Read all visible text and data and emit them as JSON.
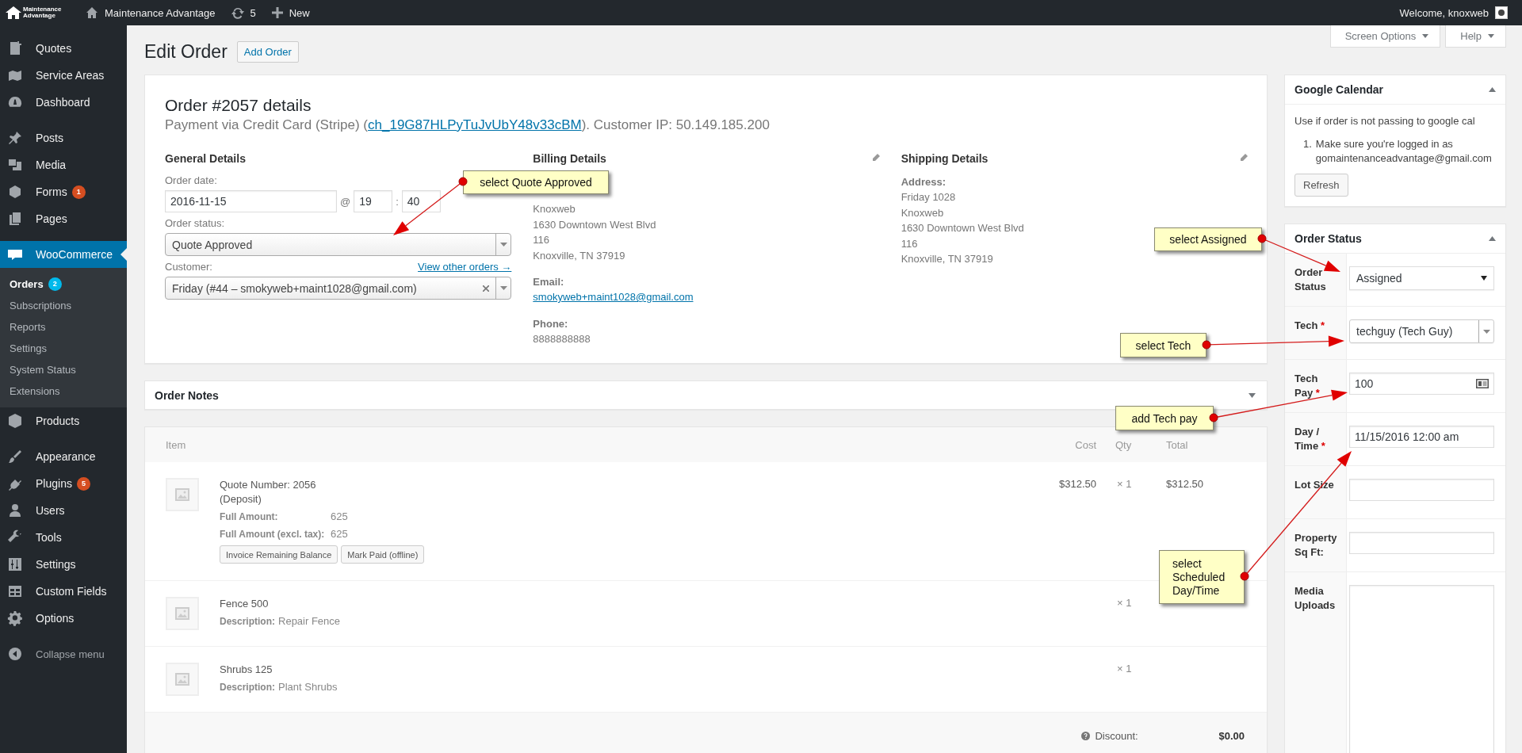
{
  "top_bar": {
    "logo_text": "Maintenance Advantage",
    "site_name": "Maintenance Advantage",
    "updates": "5",
    "new_label": "New",
    "welcome": "Welcome, knoxweb"
  },
  "sidebar": {
    "groups": [
      [
        {
          "label": "Quotes",
          "selected": false
        },
        {
          "label": "Service Areas",
          "selected": false
        },
        {
          "label": "Dashboard",
          "selected": false
        }
      ],
      [
        {
          "label": "Posts",
          "selected": false
        },
        {
          "label": "Media",
          "selected": false
        },
        {
          "label": "Forms",
          "selected": false,
          "badge": "1",
          "color": "#d54e21"
        },
        {
          "label": "Pages",
          "selected": false
        }
      ],
      [
        {
          "label": "WooCommerce",
          "selected": true,
          "children": [
            {
              "label": "Orders",
              "selected": true,
              "badge": "2",
              "color": "#00b9eb"
            },
            {
              "label": "Subscriptions",
              "selected": false
            },
            {
              "label": "Reports",
              "selected": false
            },
            {
              "label": "Settings",
              "selected": false
            },
            {
              "label": "System Status",
              "selected": false
            },
            {
              "label": "Extensions",
              "selected": false
            }
          ]
        },
        {
          "label": "Products",
          "selected": false
        }
      ],
      [
        {
          "label": "Appearance",
          "selected": false
        },
        {
          "label": "Plugins",
          "selected": false,
          "badge": "5",
          "color": "#d54e21"
        },
        {
          "label": "Users",
          "selected": false
        },
        {
          "label": "Tools",
          "selected": false
        },
        {
          "label": "Settings",
          "selected": false
        },
        {
          "label": "Custom Fields",
          "selected": false
        },
        {
          "label": "Options",
          "selected": false
        }
      ]
    ],
    "collapse_label": "Collapse menu"
  },
  "header": {
    "title": "Edit Order",
    "add_button": "Add Order",
    "screen_options": "Screen Options",
    "help": "Help"
  },
  "order": {
    "title": "Order #2057 details",
    "payment_prefix": "Payment via Credit Card (Stripe) (",
    "payment_link": "ch_19G87HLPyTuJvUbY48v33cBM",
    "payment_suffix": "). Customer IP: 50.149.185.200",
    "general": {
      "heading": "General Details",
      "date_label": "Order date:",
      "date": "2016-11-15",
      "at": "@",
      "hour": "19",
      "colon": ":",
      "minute": "40",
      "status_label": "Order status:",
      "status": "Quote Approved",
      "customer_label": "Customer:",
      "view_orders": "View other orders →",
      "customer": "Friday (#44 – smokyweb+maint1028@gmail.com)"
    },
    "billing": {
      "heading": "Billing Details",
      "lines": [
        "Knoxweb",
        "1630 Downtown West Blvd",
        "116",
        "Knoxville, TN 37919"
      ],
      "email_label": "Email:",
      "email": "smokyweb+maint1028@gmail.com",
      "phone_label": "Phone:",
      "phone": "8888888888"
    },
    "shipping": {
      "heading": "Shipping Details",
      "address_label": "Address:",
      "lines": [
        "Friday 1028",
        "Knoxweb",
        "1630 Downtown West Blvd",
        "116",
        "Knoxville, TN 37919"
      ]
    }
  },
  "order_notes": {
    "title": "Order Notes"
  },
  "items": {
    "columns": [
      "Item",
      "Cost",
      "Qty",
      "Total"
    ],
    "rows": [
      {
        "name_lines": [
          "Quote Number: 2056",
          "(Deposit)"
        ],
        "meta": [
          {
            "label": "Full Amount:",
            "value": "625"
          },
          {
            "label": "Full Amount (excl. tax):",
            "value": "625"
          }
        ],
        "buttons": [
          "Invoice Remaining Balance",
          "Mark Paid (offline)"
        ],
        "cost": "$312.50",
        "qty": "× 1",
        "total": "$312.50"
      },
      {
        "name_lines": [
          "Fence 500"
        ],
        "meta": [
          {
            "label": "Description:",
            "value": "Repair Fence"
          }
        ],
        "qty": "× 1"
      },
      {
        "name_lines": [
          "Shrubs 125"
        ],
        "meta": [
          {
            "label": "Description:",
            "value": "Plant Shrubs"
          }
        ],
        "qty": "× 1"
      }
    ],
    "discount_label": "Discount:",
    "discount": "$0.00"
  },
  "google_calendar": {
    "title": "Google Calendar",
    "text": "Use if order is not passing to google cal",
    "list": [
      {
        "number": "1.",
        "text": "Make sure you're logged in as gomaintenanceadvantage@gmail.com"
      }
    ],
    "button": "Refresh"
  },
  "order_status": {
    "title": "Order Status",
    "fields": [
      {
        "label": "Order Status",
        "kind": "select",
        "value": "Assigned"
      },
      {
        "label": "Tech",
        "kind": "combo",
        "value": "techguy (Tech Guy)",
        "required_mark": "*"
      },
      {
        "label": "Tech Pay",
        "kind": "cardtext",
        "value": "100",
        "required_mark": "*"
      },
      {
        "label": "Day / Time",
        "kind": "text",
        "value": "11/15/2016 12:00 am",
        "required_mark": "*"
      },
      {
        "label": "Lot Size",
        "kind": "text"
      },
      {
        "label": "Property Sq Ft:",
        "kind": "text"
      },
      {
        "label": "Media Uploads",
        "kind": "textarea"
      }
    ]
  },
  "callouts": [
    {
      "text": "select Quote Approved"
    },
    {
      "text": "select Assigned"
    },
    {
      "text": "select Tech"
    },
    {
      "text": "add Tech pay"
    },
    {
      "text": "select Scheduled Day/Time"
    }
  ]
}
